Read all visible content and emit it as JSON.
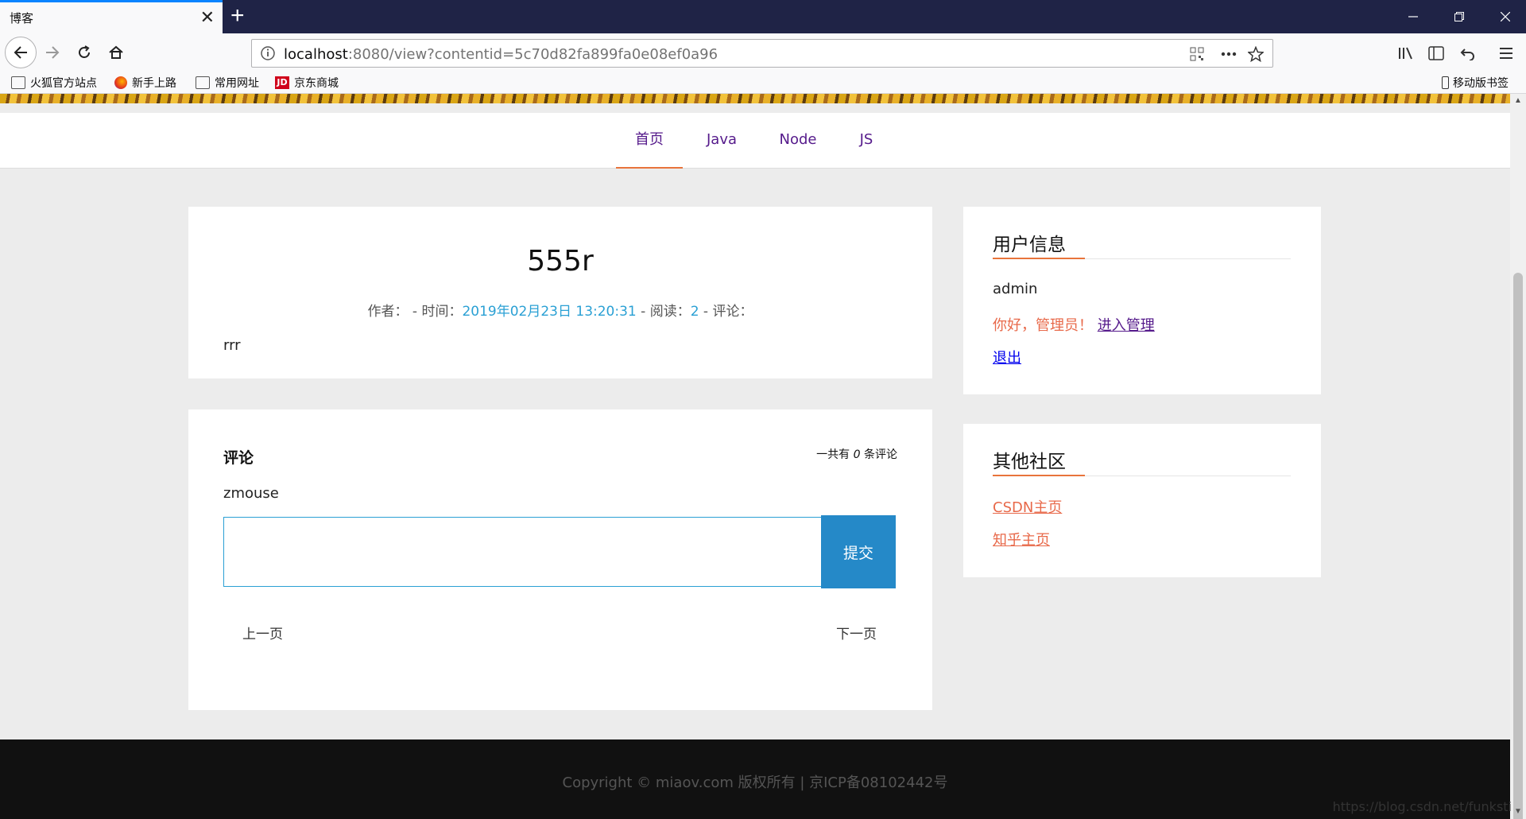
{
  "browser": {
    "tab_title": "博客",
    "tab_close": "✕",
    "new_tab": "+",
    "url_host": "localhost",
    "url_rest": ":8080/view?contentid=5c70d82fa899fa0e08ef0a96",
    "bookmarks": [
      "火狐官方站点",
      "新手上路",
      "常用网址",
      "京东商城"
    ],
    "mobile_bookmarks": "移动版书签",
    "jd_icon": "JD"
  },
  "site_nav": {
    "items": [
      "首页",
      "Java",
      "Node",
      "JS"
    ],
    "active_index": 0
  },
  "article": {
    "title": "555r",
    "meta_author_label": "作者：",
    "meta_sep1": " - 时间：",
    "meta_time": "2019年02月23日 13:20:31",
    "meta_sep2": " - 阅读：",
    "meta_reads": "2",
    "meta_sep3": " - 评论：",
    "body": "rrr"
  },
  "comments": {
    "heading": "评论",
    "count_prefix": "一共有 ",
    "count": "0",
    "count_suffix": " 条评论",
    "current_user": "zmouse",
    "submit_label": "提交",
    "prev_label": "上一页",
    "next_label": "下一页"
  },
  "user_panel": {
    "title": "用户信息",
    "username": "admin",
    "greeting": "你好，管理员！",
    "manage_link": "进入管理",
    "logout_link": "退出"
  },
  "community_panel": {
    "title": "其他社区",
    "links": [
      "CSDN主页",
      "知乎主页"
    ]
  },
  "footer": {
    "text": "Copyright © miaov.com 版权所有 | 京ICP备08102442号"
  },
  "watermark": "https://blog.csdn.net/funksti",
  "colors": {
    "accent_orange": "#e8743b",
    "link_orange": "#e8694a",
    "highlight_blue": "#2aa0d4",
    "button_blue": "#2589c8",
    "nav_purple": "#551a8b"
  }
}
